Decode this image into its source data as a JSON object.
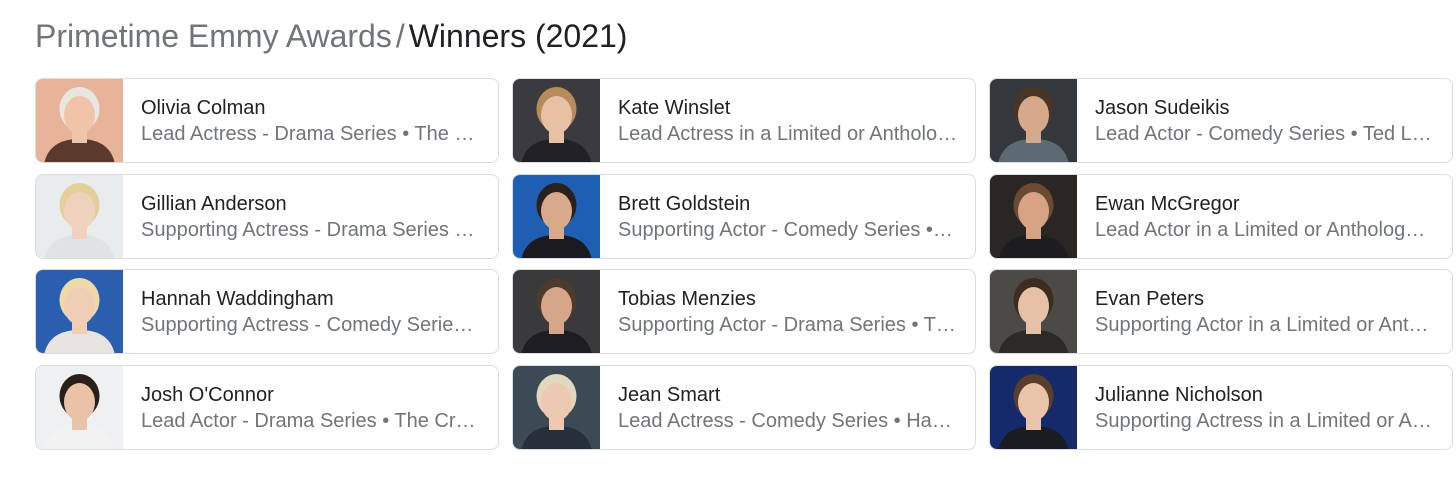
{
  "breadcrumb": {
    "parent": "Primetime Emmy Awards",
    "separator": "/",
    "current": "Winners (2021)"
  },
  "winners": [
    {
      "name": "Olivia Colman",
      "role": "Lead Actress - Drama Series • The Crown",
      "image": "portrait-photo",
      "bg": "#e7b49a",
      "skin": "#f0c4a8",
      "hair": "#e9e6df",
      "shirt": "#5b3a2e"
    },
    {
      "name": "Kate Winslet",
      "role": "Lead Actress in a Limited or Anthology Series • Mare of Easttown",
      "image": "portrait-photo",
      "bg": "#3b3b3f",
      "skin": "#e8c0a4",
      "hair": "#b88c5a",
      "shirt": "#222226"
    },
    {
      "name": "Jason Sudeikis",
      "role": "Lead Actor - Comedy Series • Ted Lasso",
      "image": "portrait-photo",
      "bg": "#34383c",
      "skin": "#d6a98a",
      "hair": "#4a3524",
      "shirt": "#5d6a74"
    },
    {
      "name": "Gillian Anderson",
      "role": "Supporting Actress - Drama Series • The Crown",
      "image": "portrait-photo",
      "bg": "#e9ecec",
      "skin": "#efd1bd",
      "hair": "#e3cf9a",
      "shirt": "#dfe3e3"
    },
    {
      "name": "Brett Goldstein",
      "role": "Supporting Actor - Comedy Series • Ted Lasso",
      "image": "portrait-photo",
      "bg": "#1f5fb3",
      "skin": "#d8a98a",
      "hair": "#2a211c",
      "shirt": "#1b1b1f"
    },
    {
      "name": "Ewan McGregor",
      "role": "Lead Actor in a Limited or Anthology Series • Halston",
      "image": "portrait-photo",
      "bg": "#2a2624",
      "skin": "#d7a384",
      "hair": "#6b4a33",
      "shirt": "#1d1d1f"
    },
    {
      "name": "Hannah Waddingham",
      "role": "Supporting Actress - Comedy Series • Ted Lasso",
      "image": "portrait-photo",
      "bg": "#2a5fb0",
      "skin": "#f0cdb5",
      "hair": "#efd9a6",
      "shirt": "#e7e3de"
    },
    {
      "name": "Tobias Menzies",
      "role": "Supporting Actor - Drama Series • The Crown",
      "image": "portrait-photo",
      "bg": "#3a3a3c",
      "skin": "#d6a68a",
      "hair": "#4c3a2c",
      "shirt": "#1e1e22"
    },
    {
      "name": "Evan Peters",
      "role": "Supporting Actor in a Limited or Anthology Series • Mare of Easttown",
      "image": "portrait-photo",
      "bg": "#4c4a46",
      "skin": "#e6c1a7",
      "hair": "#3e2c20",
      "shirt": "#2b2a28"
    },
    {
      "name": "Josh O'Connor",
      "role": "Lead Actor - Drama Series • The Crown",
      "image": "portrait-photo",
      "bg": "#eef0f2",
      "skin": "#e9c2a7",
      "hair": "#2a2019",
      "shirt": "#f2f2f2"
    },
    {
      "name": "Jean Smart",
      "role": "Lead Actress - Comedy Series • Hacks",
      "image": "portrait-photo",
      "bg": "#3c4a55",
      "skin": "#edc9b1",
      "hair": "#e4d7bf",
      "shirt": "#27303a"
    },
    {
      "name": "Julianne Nicholson",
      "role": "Supporting Actress in a Limited or Anthology Series • Mare of Easttown",
      "image": "portrait-photo",
      "bg": "#152a6a",
      "skin": "#e9c4ab",
      "hair": "#5a3d2a",
      "shirt": "#1b1b22"
    }
  ]
}
